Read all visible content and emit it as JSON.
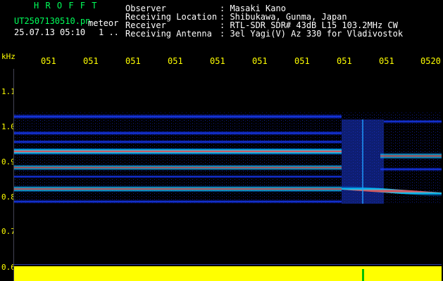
{
  "header": {
    "station": "H R O F F T",
    "filename": "UT2507130510.pn",
    "mode": "meteor",
    "datetime": "25.07.13 05:10",
    "page_indicator": "1 ..",
    "fields": [
      {
        "label": "Observer",
        "value": ": Masaki Kano"
      },
      {
        "label": "Receiving Location",
        "value": ": Shibukawa, Gunma, Japan"
      },
      {
        "label": "Receiver",
        "value": ": RTL-SDR SDR# 43dB L15 103.2MHz CW"
      },
      {
        "label": "Receiving Antenna",
        "value": ": 3el Yagi(V) Az 330 for Vladivostok"
      }
    ]
  },
  "x_axis": {
    "ticks": [
      "051",
      "051",
      "051",
      "051",
      "051",
      "051",
      "051",
      "051",
      "051",
      "0520"
    ]
  },
  "y_axis": {
    "unit": "kHz",
    "ticks": [
      "1.1",
      "1.0",
      "0.9",
      "0.8",
      "0.7",
      "0.6"
    ]
  },
  "colors": {
    "label_yellow": "#ffff00",
    "title_green": "#00ff5a",
    "signal_low": "#1030ff",
    "signal_mid": "#00e0ff",
    "signal_high": "#ff3030",
    "noise_floor": "#ffff00"
  }
}
